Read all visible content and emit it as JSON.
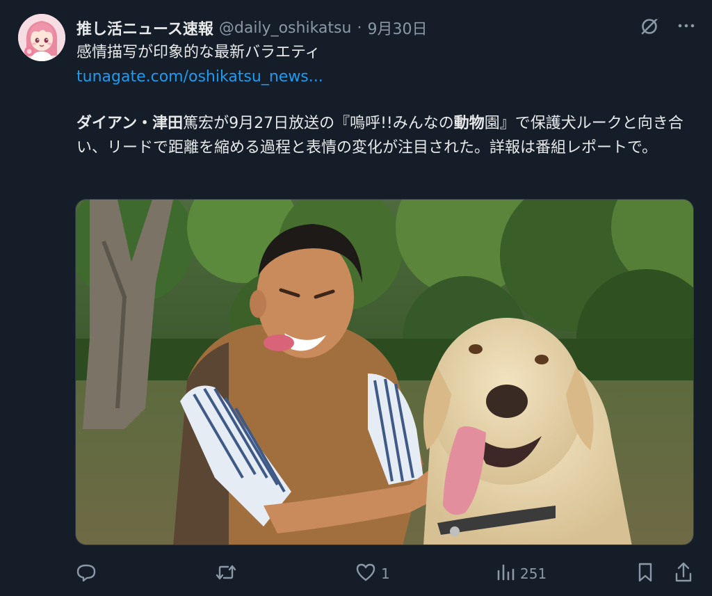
{
  "tweet": {
    "display_name": "推し活ニュース速報",
    "handle": "@daily_oshikatsu",
    "separator": "·",
    "date": "9月30日",
    "text_line1": "感情描写が印象的な最新バラエティ",
    "link": "tunagate.com/oshikatsu_news...",
    "body": {
      "b1": "ダイアン・津田",
      "t1": "篤宏が9月27日放送の『嗚呼!!みんなの",
      "b2": "動物",
      "t2": "園』で保護犬ルークと向き合い、リードで距離を縮める過程と表情の変化が注目された。詳報は番組レポートで。"
    }
  },
  "actions": {
    "reply_count": "",
    "retweet_count": "",
    "like_count": "1",
    "views_count": "251"
  },
  "icons": {
    "top": [
      "grok-icon",
      "more-icon"
    ],
    "bottom": [
      "reply-icon",
      "retweet-icon",
      "like-icon",
      "views-icon",
      "bookmark-icon",
      "share-icon"
    ]
  },
  "colors": {
    "background": "#151d28",
    "text": "#e7e9ea",
    "muted": "#8b98a5",
    "link": "#1d9bf0"
  }
}
